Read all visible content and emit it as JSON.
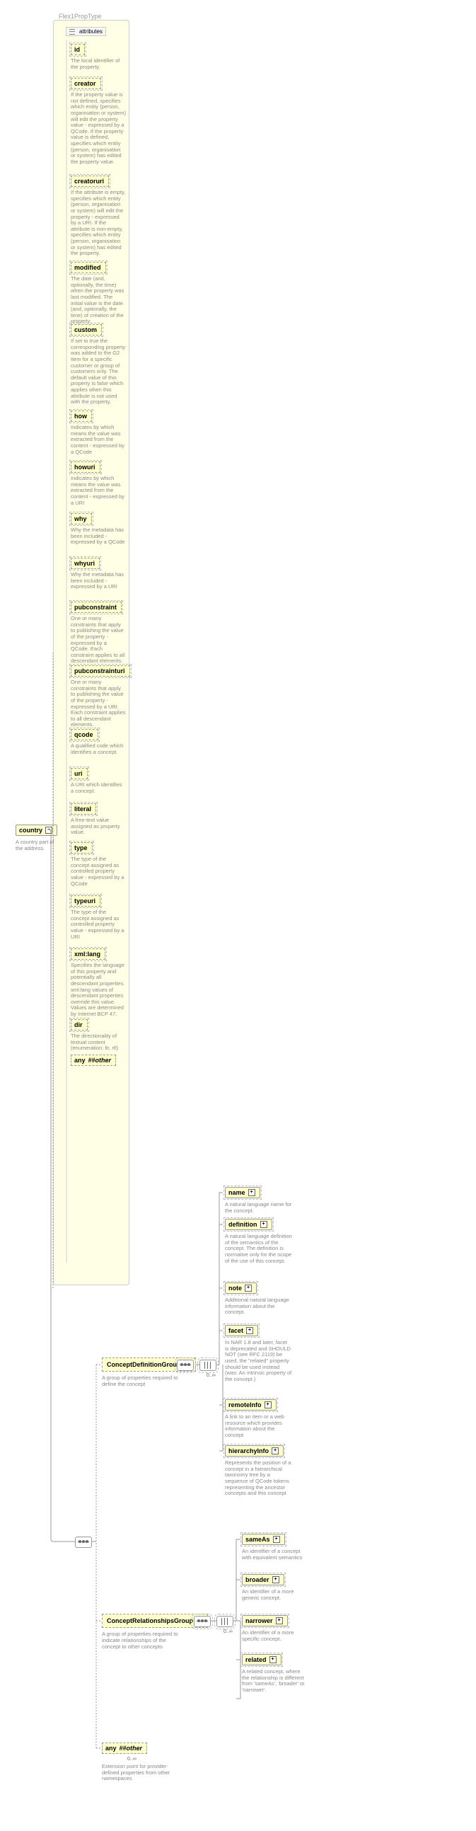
{
  "type_label": "Flex1PropType",
  "root": {
    "name": "country",
    "desc": "A country part of the address."
  },
  "attributes_header": "attributes",
  "attributes": [
    {
      "name": "id",
      "desc": "The local identifier of the property."
    },
    {
      "name": "creator",
      "desc": "If the property value is not defined, specifies which entity (person, organisation or system) will edit the property value - expressed by a QCode. If the property value is defined, specifies which entity (person, organisation or system) has edited the property value."
    },
    {
      "name": "creatoruri",
      "desc": "If the attribute is empty, specifies which entity (person, organisation or system) will edit the property - expressed by a URI. If the attribute is non-empty, specifies which entity (person, organisation or system) has edited the property."
    },
    {
      "name": "modified",
      "desc": "The date (and, optionally, the time) when the property was last modified. The initial value is the date (and, optionally, the time) of creation of the property."
    },
    {
      "name": "custom",
      "desc": "If set to true the corresponding property was added to the G2 Item for a specific customer or group of customers only. The default value of this property is false which applies when this attribute is not used with the property."
    },
    {
      "name": "how",
      "desc": "Indicates by which means the value was extracted from the content - expressed by a QCode"
    },
    {
      "name": "howuri",
      "desc": "Indicates by which means the value was extracted from the content - expressed by a URI"
    },
    {
      "name": "why",
      "desc": "Why the metadata has been included - expressed by a QCode"
    },
    {
      "name": "whyuri",
      "desc": "Why the metadata has been included - expressed by a URI"
    },
    {
      "name": "pubconstraint",
      "desc": "One or many constraints that apply to publishing the value of the property - expressed by a QCode. Each constraint applies to all descendant elements."
    },
    {
      "name": "pubconstrainturi",
      "desc": "One or many constraints that apply to publishing the value of the property - expressed by a URI. Each constraint applies to all descendant elements."
    },
    {
      "name": "qcode",
      "desc": "A qualified code which identifies a concept."
    },
    {
      "name": "uri",
      "desc": "A URI which identifies a concept."
    },
    {
      "name": "literal",
      "desc": "A free-text value assigned as property value."
    },
    {
      "name": "type",
      "desc": "The type of the concept assigned as controlled property value - expressed by a QCode"
    },
    {
      "name": "typeuri",
      "desc": "The type of the concept assigned as controlled property value - expressed by a URI"
    },
    {
      "name": "xml:lang",
      "desc": "Specifies the language of this property and potentially all descendant properties. xml:lang values of descendant properties override this value. Values are determined by Internet BCP 47."
    },
    {
      "name": "dir",
      "desc": "The directionality of textual content (enumeration: ltr, rtl)"
    }
  ],
  "any_attr": "##other",
  "groups": [
    {
      "name": "ConceptDefinitionGroup",
      "desc": "A group of properties required to define the concept"
    },
    {
      "name": "ConceptRelationshipsGroup",
      "desc": "A group of properties required to indicate relationships of the concept to other concepts"
    }
  ],
  "def_elements": [
    {
      "name": "name",
      "desc": "A natural language name for the concept."
    },
    {
      "name": "definition",
      "desc": "A natural language definition of the semantics of the concept. The definition is normative only for the scope of the use of this concept."
    },
    {
      "name": "note",
      "desc": "Additional natural language information about the concept."
    },
    {
      "name": "facet",
      "desc": "In NAR 1.8 and later, facet is deprecated and SHOULD NOT (see RFC 2119) be used, the \"related\" property should be used instead (was: An intrinsic property of the concept.)"
    },
    {
      "name": "remoteInfo",
      "desc": "A link to an item or a web resource which provides information about the concept"
    },
    {
      "name": "hierarchyInfo",
      "desc": "Represents the position of a concept in a hierarchical taxonomy tree by a sequence of QCode tokens representing the ancestor concepts and this concept"
    }
  ],
  "rel_elements": [
    {
      "name": "sameAs",
      "desc": "An identifier of a concept with equivalent semantics"
    },
    {
      "name": "broader",
      "desc": "An identifier of a more generic concept."
    },
    {
      "name": "narrower",
      "desc": "An identifier of a more specific concept."
    },
    {
      "name": "related",
      "desc": "A related concept, where the relationship is different from 'sameAs', 'broader' or 'narrower'."
    }
  ],
  "any_element": {
    "label": "##other",
    "occur": "0..∞",
    "desc": "Extension point for provider-defined properties from other namespaces"
  },
  "any_keyword": "any"
}
